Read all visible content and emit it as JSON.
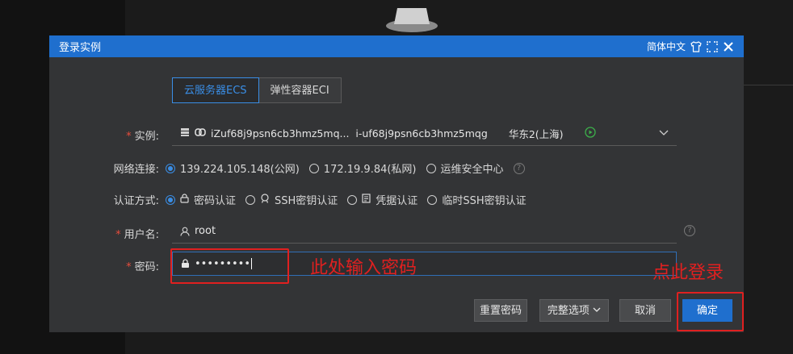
{
  "dialog": {
    "title": "登录实例",
    "lang_label": "简体中文"
  },
  "tabs": [
    {
      "label": "云服务器ECS",
      "active": true
    },
    {
      "label": "弹性容器ECI",
      "active": false
    }
  ],
  "form": {
    "instance": {
      "label": "实例:",
      "name": "iZuf68j9psn6cb3hmz5mq...",
      "id": "i-uf68j9psn6cb3hmz5mqg",
      "region": "华东2(上海)"
    },
    "network": {
      "label": "网络连接:",
      "options": [
        "139.224.105.148(公网)",
        "172.19.9.84(私网)",
        "运维安全中心"
      ]
    },
    "auth": {
      "label": "认证方式:",
      "options": [
        "密码认证",
        "SSH密钥认证",
        "凭据认证",
        "临时SSH密钥认证"
      ]
    },
    "username": {
      "label": "用户名:",
      "value": "root"
    },
    "password": {
      "label": "密码:",
      "value": "•••••••••"
    }
  },
  "buttons": {
    "reset": "重置密码",
    "options": "完整选项",
    "cancel": "取消",
    "confirm": "确定"
  },
  "annotations": {
    "password_hint": "此处输入密码",
    "login_hint": "点此登录"
  },
  "colors": {
    "accent": "#1f6fce",
    "annotation": "#e02020"
  }
}
